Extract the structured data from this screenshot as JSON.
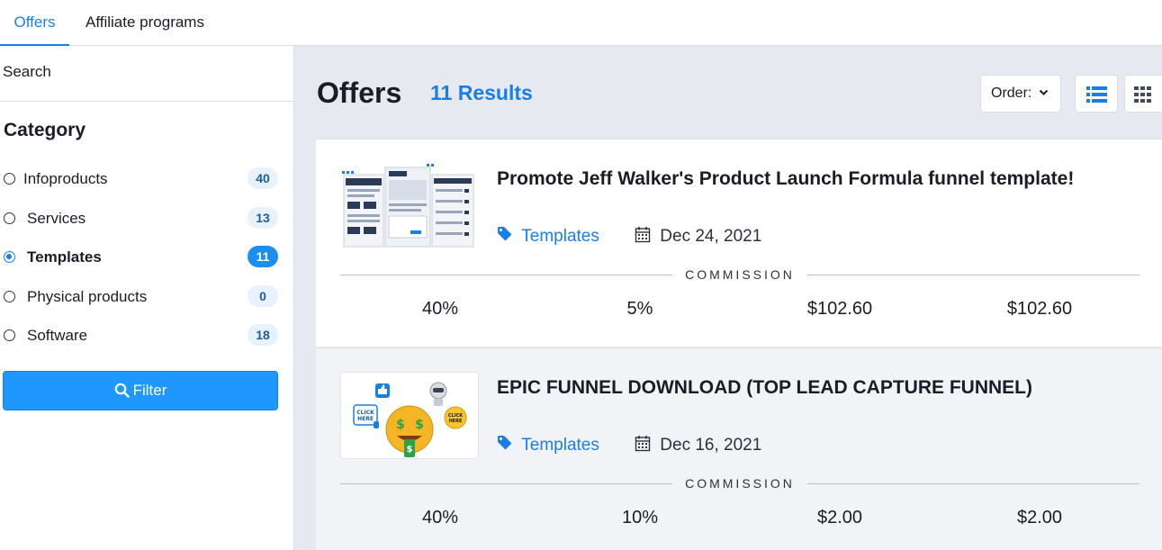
{
  "tabs": [
    {
      "label": "Offers",
      "active": true
    },
    {
      "label": "Affiliate programs",
      "active": false
    }
  ],
  "sidebar": {
    "search_label": "Search",
    "category_title": "Category",
    "categories": [
      {
        "label": "Infoproducts",
        "count": "40",
        "selected": false
      },
      {
        "label": "Services",
        "count": "13",
        "selected": false
      },
      {
        "label": "Templates",
        "count": "11",
        "selected": true
      },
      {
        "label": "Physical products",
        "count": "0",
        "selected": false
      },
      {
        "label": "Software",
        "count": "18",
        "selected": false
      }
    ],
    "filter_label": "Filter"
  },
  "main": {
    "title": "Offers",
    "results": "11 Results",
    "order_label": "Order:",
    "offers": [
      {
        "title": "Promote Jeff Walker's Product Launch Formula funnel template!",
        "category": "Templates",
        "date": "Dec 24, 2021",
        "commission_label": "COMMISSION",
        "commissions": [
          "40%",
          "5%",
          "$102.60",
          "$102.60"
        ]
      },
      {
        "title": "EPIC FUNNEL DOWNLOAD (TOP LEAD CAPTURE FUNNEL)",
        "category": "Templates",
        "date": "Dec 16, 2021",
        "commission_label": "COMMISSION",
        "commissions": [
          "40%",
          "10%",
          "$2.00",
          "$2.00"
        ]
      }
    ]
  },
  "colors": {
    "accent": "#1a7fe3",
    "filter_button": "#1e98ff",
    "main_background": "#e6e9ef"
  },
  "icons": {
    "filter": "search-icon",
    "category": "tag-icon",
    "date": "calendar-icon",
    "order": "chevron-down-icon",
    "list_view": "list-view-icon",
    "grid_view": "grid-view-icon"
  }
}
